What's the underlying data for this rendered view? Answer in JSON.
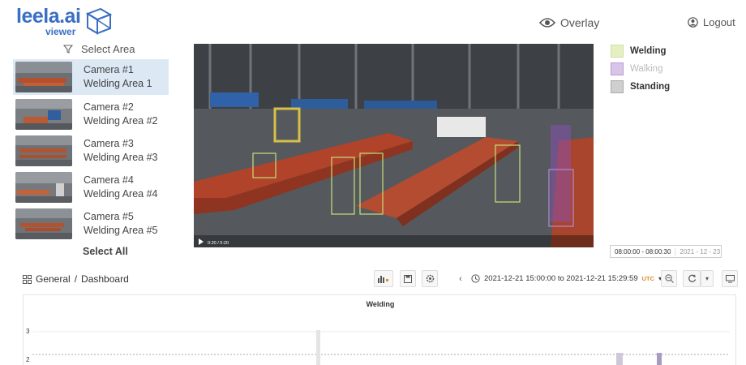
{
  "app": {
    "logo_text": "leela.ai",
    "logo_sub": "viewer"
  },
  "header": {
    "overlay_label": "Overlay",
    "logout_label": "Logout"
  },
  "sidebar": {
    "select_area_label": "Select Area",
    "cameras": [
      {
        "name": "Camera #1",
        "area": "Welding Area 1"
      },
      {
        "name": "Camera #2",
        "area": "Welding Area #2"
      },
      {
        "name": "Camera #3",
        "area": "Welding Area #3"
      },
      {
        "name": "Camera #4",
        "area": "Welding Area #4"
      },
      {
        "name": "Camera #5",
        "area": "Welding Area #5"
      }
    ],
    "select_all_label": "Select All"
  },
  "video": {
    "time": "0:20 / 0:20"
  },
  "legend": {
    "items": [
      {
        "label": "Welding",
        "color": "#e4f0c4"
      },
      {
        "label": "Walking",
        "color": "#d9c5e8"
      },
      {
        "label": "Standing",
        "color": "#cfcfcf"
      }
    ]
  },
  "timebox": {
    "range": "08:00:00 - 08:00:30",
    "date": "2021 - 12 - 23"
  },
  "toolbar": {
    "breadcrumb_root": "General",
    "breadcrumb_sep": "/",
    "breadcrumb_page": "Dashboard",
    "range_text": "2021-12-21 15:00:00 to 2021-12-21 15:29:59",
    "tz": "UTC"
  },
  "chart_data": {
    "type": "bar",
    "title": "Welding",
    "yticks": [
      "3",
      "2"
    ]
  }
}
